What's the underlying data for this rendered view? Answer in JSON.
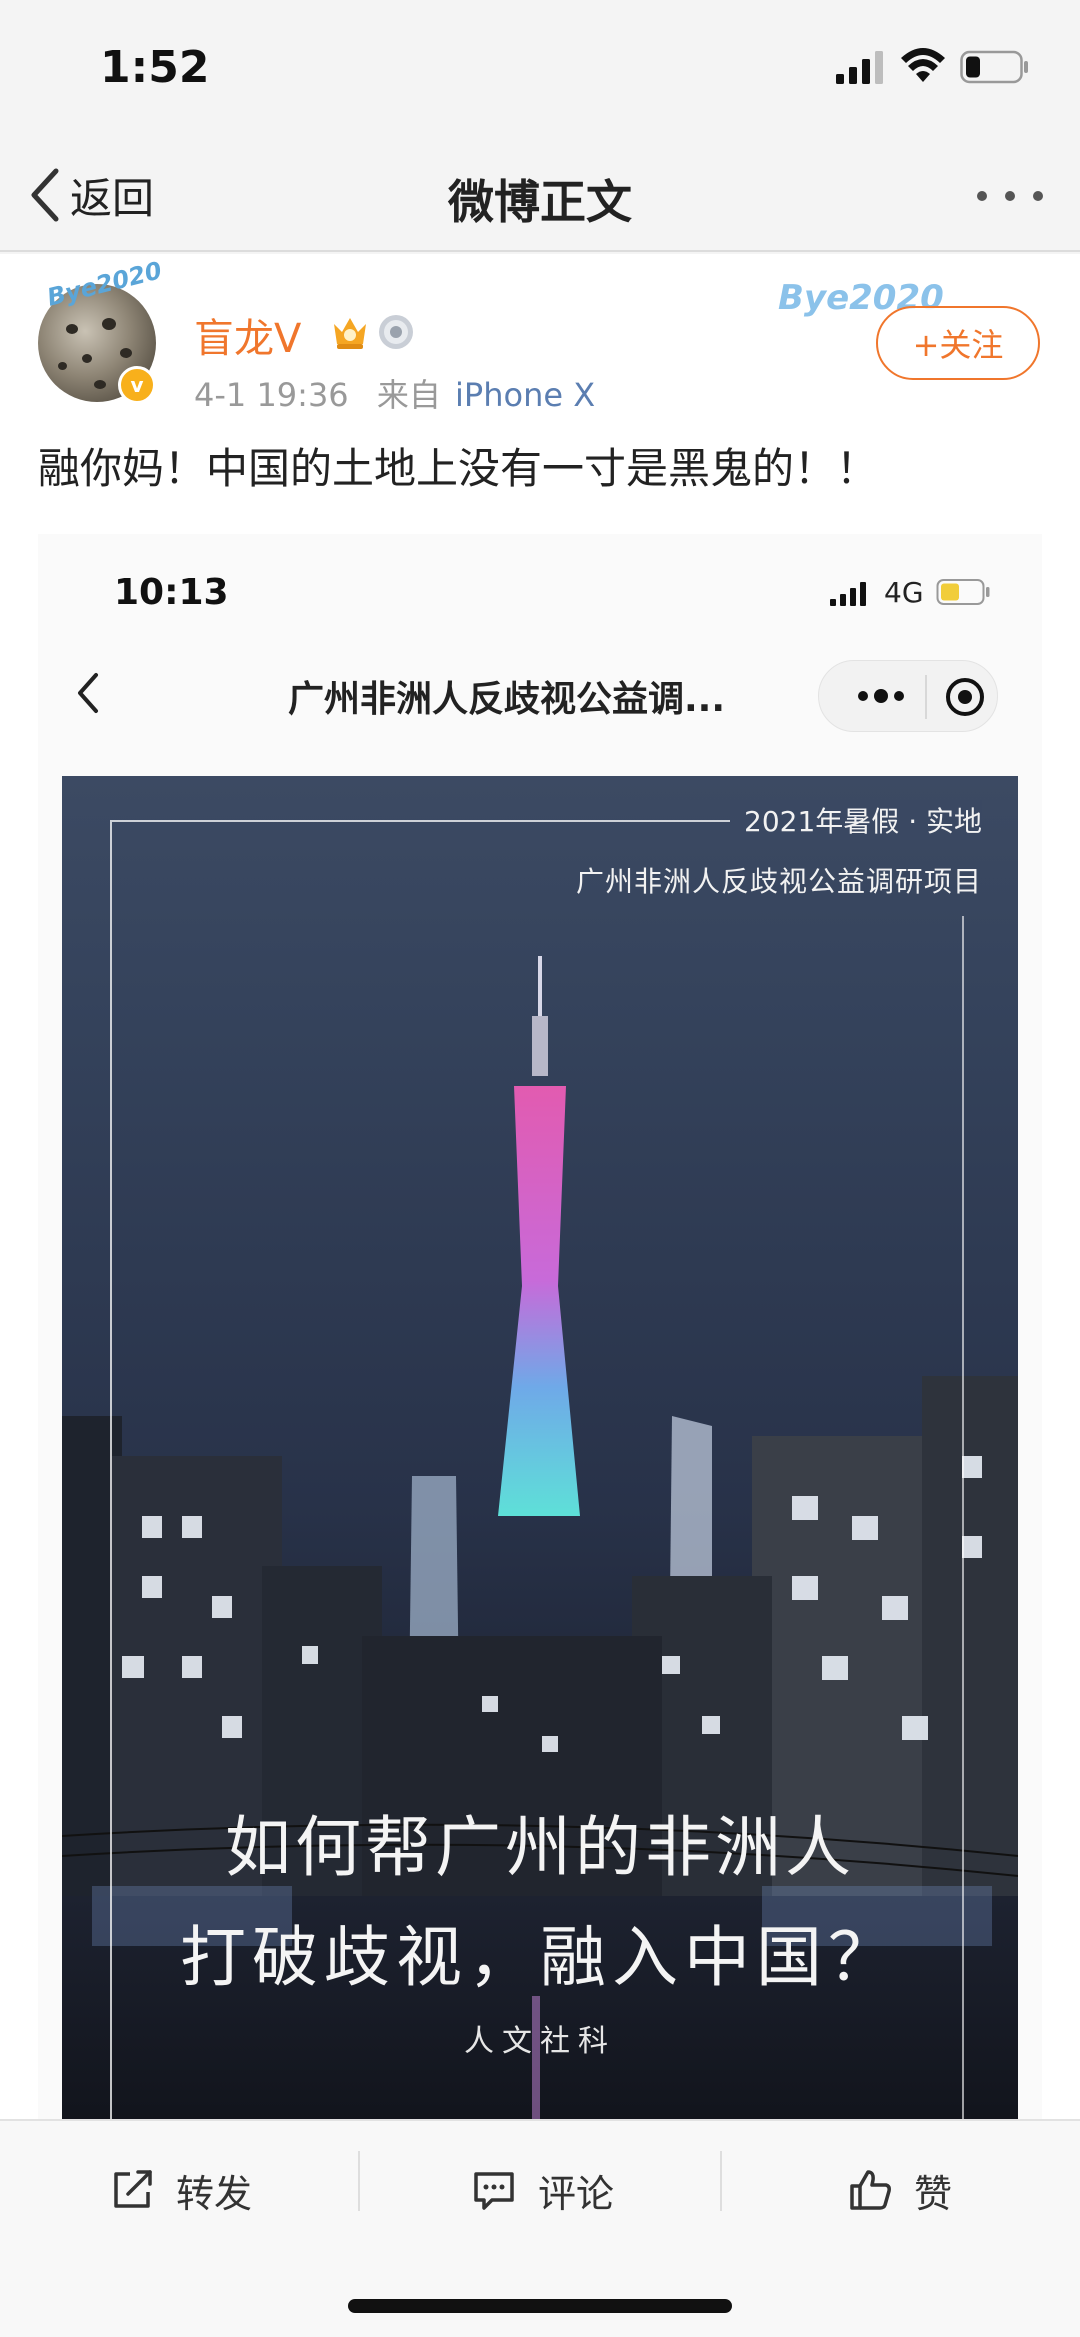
{
  "status_bar": {
    "time": "1:52"
  },
  "nav": {
    "back_label": "返回",
    "title": "微博正文"
  },
  "post": {
    "username": "盲龙V",
    "avatar_deco_text": "Bye2020",
    "verified_badge": "v",
    "time": "4-1 19:36",
    "from_label": "来自",
    "device": "iPhone X",
    "card_deco_text": "Bye2020",
    "follow_label": "+关注",
    "text": "融你妈！中国的土地上没有一寸是黑鬼的！！"
  },
  "embedded_screenshot": {
    "time": "10:13",
    "network": "4G",
    "title": "广州非洲人反歧视公益调...",
    "poster": {
      "tag_line1": "2021年暑假 · 实地",
      "tag_line2": "广州非洲人反歧视公益调研项目",
      "headline1": "如何帮广州的非洲人",
      "headline2": "打破歧视，融入中国？",
      "footer": "人文社科"
    }
  },
  "actions": {
    "repost": "转发",
    "comment": "评论",
    "like": "赞"
  },
  "colors": {
    "accent_orange": "#f0762c",
    "link_blue": "#5b7eb1",
    "verified_gold": "#f8b01b"
  },
  "icons": [
    "signal-icon",
    "wifi-icon",
    "battery-icon",
    "back-chevron-icon",
    "more-icon",
    "crown-medal-icon",
    "badge-medal-icon",
    "repost-icon",
    "comment-icon",
    "like-icon",
    "target-icon"
  ]
}
